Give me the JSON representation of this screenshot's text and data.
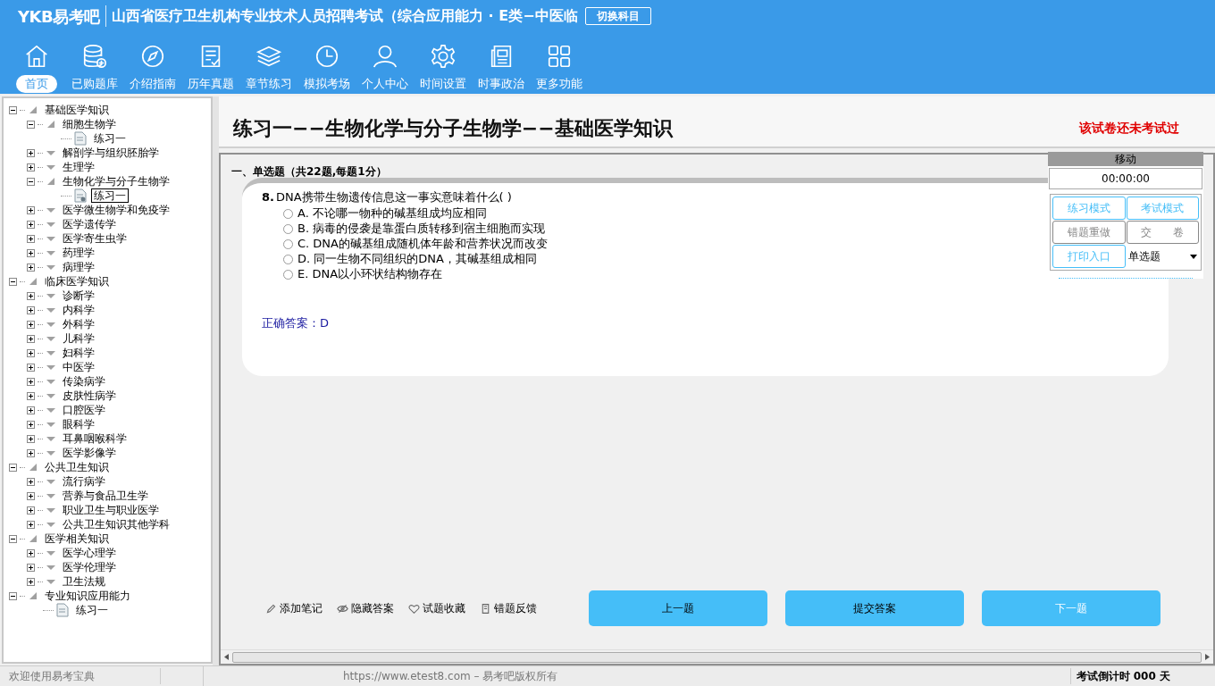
{
  "header": {
    "logo": "YKB易考吧",
    "title": "山西省医疗卫生机构专业技术人员招聘考试（综合应用能力 · E类−中医临",
    "switch_button": "切换科目"
  },
  "nav": [
    {
      "label": "首页",
      "selected": true
    },
    {
      "label": "已购题库",
      "selected": false
    },
    {
      "label": "介绍指南",
      "selected": false
    },
    {
      "label": "历年真题",
      "selected": false
    },
    {
      "label": "章节练习",
      "selected": false
    },
    {
      "label": "模拟考场",
      "selected": false
    },
    {
      "label": "个人中心",
      "selected": false
    },
    {
      "label": "时间设置",
      "selected": false
    },
    {
      "label": "时事政治",
      "selected": false
    },
    {
      "label": "更多功能",
      "selected": false
    }
  ],
  "tree": [
    {
      "label": "基础医学知识",
      "kind": "folder",
      "expanded": true,
      "children": [
        {
          "label": "细胞生物学",
          "kind": "folder",
          "expanded": true,
          "children": [
            {
              "label": "练习一",
              "kind": "exercise",
              "selected": false
            }
          ]
        },
        {
          "label": "解剖学与组织胚胎学",
          "kind": "folder",
          "expanded": false
        },
        {
          "label": "生理学",
          "kind": "folder",
          "expanded": false
        },
        {
          "label": "生物化学与分子生物学",
          "kind": "folder",
          "expanded": true,
          "children": [
            {
              "label": "练习一",
              "kind": "exercise",
              "selected": true
            }
          ]
        },
        {
          "label": "医学微生物学和免疫学",
          "kind": "folder",
          "expanded": false
        },
        {
          "label": "医学遗传学",
          "kind": "folder",
          "expanded": false
        },
        {
          "label": "医学寄生虫学",
          "kind": "folder",
          "expanded": false
        },
        {
          "label": "药理学",
          "kind": "folder",
          "expanded": false
        },
        {
          "label": "病理学",
          "kind": "folder",
          "expanded": false
        }
      ]
    },
    {
      "label": "临床医学知识",
      "kind": "folder",
      "expanded": true,
      "children": [
        {
          "label": "诊断学",
          "kind": "folder",
          "expanded": false
        },
        {
          "label": "内科学",
          "kind": "folder",
          "expanded": false
        },
        {
          "label": "外科学",
          "kind": "folder",
          "expanded": false
        },
        {
          "label": "儿科学",
          "kind": "folder",
          "expanded": false
        },
        {
          "label": "妇科学",
          "kind": "folder",
          "expanded": false
        },
        {
          "label": "中医学",
          "kind": "folder",
          "expanded": false
        },
        {
          "label": "传染病学",
          "kind": "folder",
          "expanded": false
        },
        {
          "label": "皮肤性病学",
          "kind": "folder",
          "expanded": false
        },
        {
          "label": "口腔医学",
          "kind": "folder",
          "expanded": false
        },
        {
          "label": "眼科学",
          "kind": "folder",
          "expanded": false
        },
        {
          "label": "耳鼻咽喉科学",
          "kind": "folder",
          "expanded": false
        },
        {
          "label": "医学影像学",
          "kind": "folder",
          "expanded": false
        }
      ]
    },
    {
      "label": "公共卫生知识",
      "kind": "folder",
      "expanded": true,
      "children": [
        {
          "label": "流行病学",
          "kind": "folder",
          "expanded": false
        },
        {
          "label": "营养与食品卫生学",
          "kind": "folder",
          "expanded": false
        },
        {
          "label": "职业卫生与职业医学",
          "kind": "folder",
          "expanded": false
        },
        {
          "label": "公共卫生知识其他学科",
          "kind": "folder",
          "expanded": false
        }
      ]
    },
    {
      "label": "医学相关知识",
      "kind": "folder",
      "expanded": true,
      "children": [
        {
          "label": "医学心理学",
          "kind": "folder",
          "expanded": false
        },
        {
          "label": "医学伦理学",
          "kind": "folder",
          "expanded": false
        },
        {
          "label": "卫生法规",
          "kind": "folder",
          "expanded": false
        }
      ]
    },
    {
      "label": "专业知识应用能力",
      "kind": "folder",
      "expanded": true,
      "children": [
        {
          "label": "练习一",
          "kind": "exercise",
          "selected": false
        }
      ]
    }
  ],
  "paper": {
    "title": "练习一−−生物化学与分子生物学−−基础医学知识",
    "status": "该试卷还未考试过",
    "section": "一、单选题（共22题,每题1分）",
    "question": {
      "number": "8.",
      "text": "DNA携带生物遗传信息这一事实意味着什么( )",
      "options": [
        {
          "text": "A. 不论哪一物种的碱基组成均应相同",
          "checked": false
        },
        {
          "text": "B. 病毒的侵袭是靠蛋白质转移到宿主细胞而实现",
          "checked": false
        },
        {
          "text": "C. DNA的碱基组成随机体年龄和营养状况而改变",
          "checked": false
        },
        {
          "text": "D. 同一生物不同组织的DNA，其碱基组成相同",
          "checked": false
        },
        {
          "text": "E. DNA以小环状结构物存在",
          "checked": false
        }
      ],
      "answer": "正确答案：D"
    }
  },
  "panel": {
    "handle": "移动",
    "timer": "00:00:00",
    "buttons": [
      {
        "label": "练习模式",
        "disabled": false
      },
      {
        "label": "考试模式",
        "disabled": false
      },
      {
        "label": "错题重做",
        "disabled": true
      },
      {
        "label": "交　　卷",
        "disabled": true
      },
      {
        "label": "打印入口",
        "disabled": false
      }
    ],
    "dropdown": "单选题"
  },
  "actions": [
    "添加笔记",
    "隐藏答案",
    "试题收藏",
    "错题反馈"
  ],
  "buttons": [
    "上一题",
    "提交答案",
    "下一题"
  ],
  "status_bar": {
    "welcome": "欢迎使用易考宝典",
    "copyright": "https://www.etest8.com – 易考吧版权所有",
    "countdown": "考试倒计时 000 天"
  }
}
